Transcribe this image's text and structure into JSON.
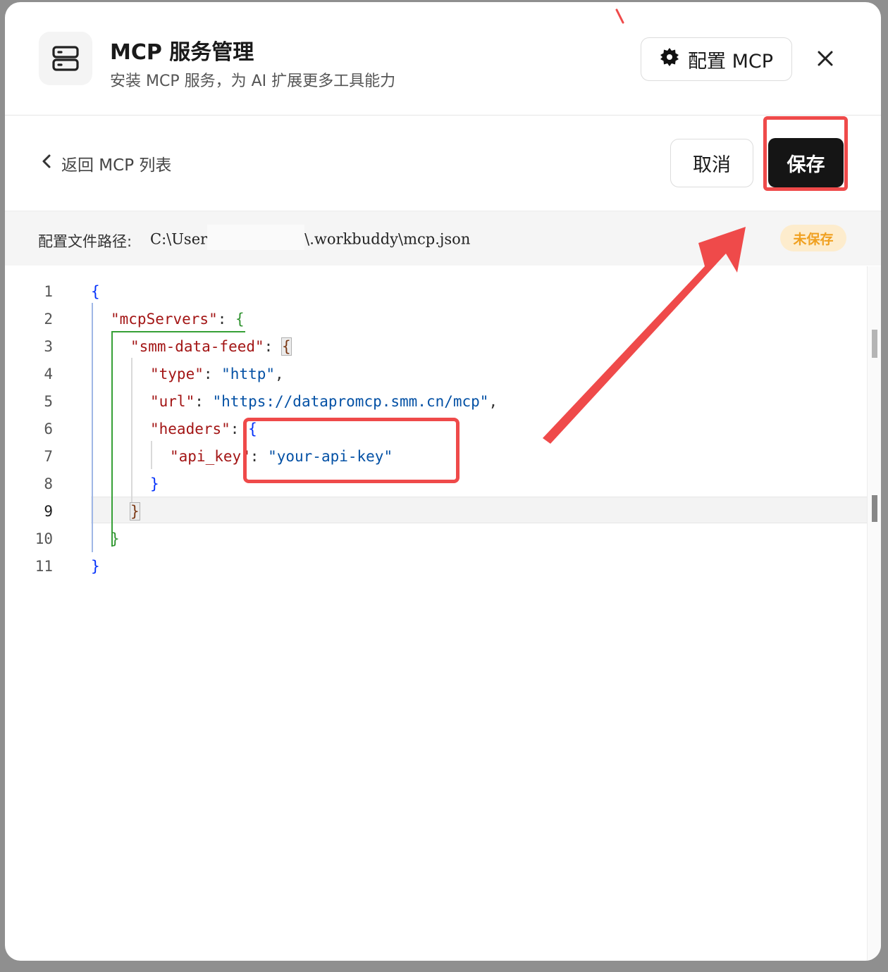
{
  "dialog": {
    "title": "MCP 服务管理",
    "subtitle": "安装 MCP 服务，为 AI 扩展更多工具能力",
    "config_button_label": "配置 MCP",
    "icons": {
      "header": "server-icon",
      "config": "gear-icon",
      "close": "close-icon"
    }
  },
  "toolbar": {
    "back_label": "返回 MCP 列表",
    "cancel_label": "取消",
    "save_label": "保存"
  },
  "path_bar": {
    "label": "配置文件路径:",
    "path_prefix": "C:\\User",
    "path_suffix": "\\.workbuddy\\mcp.json",
    "status_badge": "未保存"
  },
  "editor": {
    "line_numbers": [
      "1",
      "2",
      "3",
      "4",
      "5",
      "6",
      "7",
      "8",
      "9",
      "10",
      "11"
    ],
    "active_line": 9,
    "tokens": {
      "open_root": "{",
      "key_mcpServers": "\"mcpServers\"",
      "colon_1": ": ",
      "open_servers": "{",
      "key_server": "\"smm-data-feed\"",
      "colon_2": ": ",
      "open_server": "{",
      "key_type": "\"type\"",
      "colon_3": ": ",
      "val_type": "\"http\"",
      "comma_1": ",",
      "key_url": "\"url\"",
      "colon_4": ": ",
      "val_url": "\"https://datapromcp.smm.cn/mcp\"",
      "comma_2": ",",
      "key_headers": "\"headers\"",
      "colon_5": ": ",
      "open_headers": "{",
      "key_api_key": "\"api_key\"",
      "colon_6": ": ",
      "val_api_key": "\"your-api-key\"",
      "close_headers": "}",
      "close_server": "}",
      "close_servers": "}",
      "close_root": "}"
    }
  },
  "colors": {
    "annotation_red": "#ef4a4a",
    "save_button_bg": "#151515",
    "badge_bg": "#fdeccd",
    "badge_text": "#f0a020",
    "json_key": "#a31515",
    "json_string": "#0451a5"
  }
}
